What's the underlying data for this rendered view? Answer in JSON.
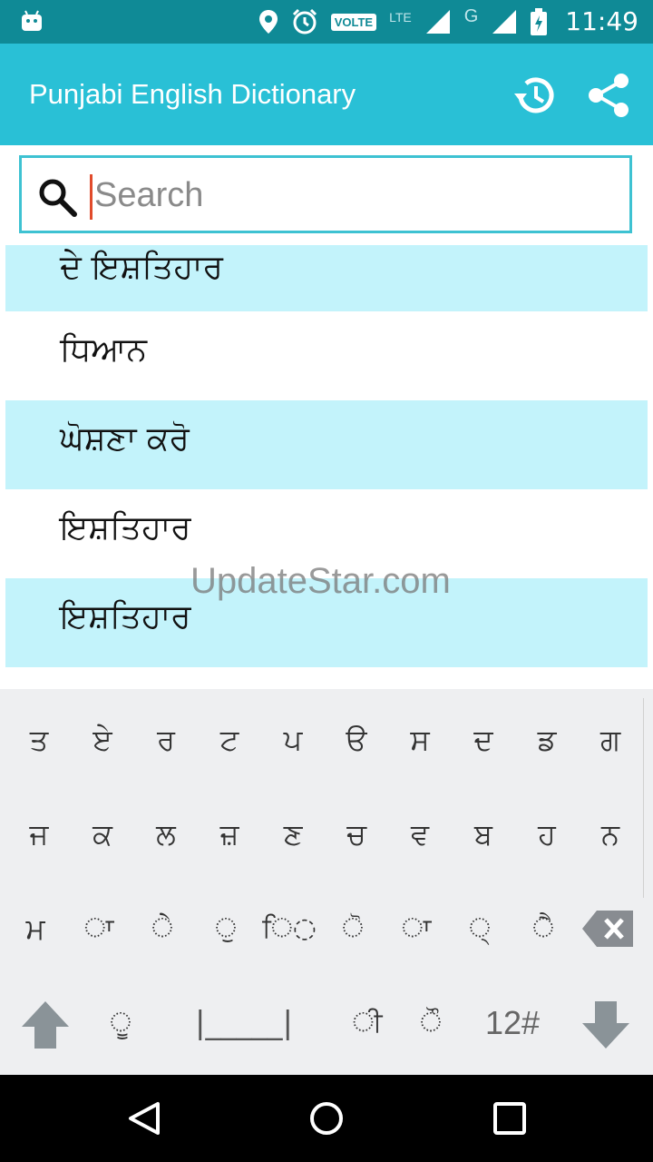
{
  "status_bar": {
    "time": "11:49",
    "volte_label": "VOLTE",
    "lte_label": "LTE",
    "g_label": "G",
    "icons": [
      "android-icon",
      "location-icon",
      "alarm-icon",
      "volte-icon",
      "signal-icon",
      "battery-icon"
    ]
  },
  "app_bar": {
    "title": "Punjabi English Dictionary",
    "icons": [
      "history-icon",
      "share-icon"
    ]
  },
  "search": {
    "placeholder": "Search",
    "value": ""
  },
  "results": [
    {
      "text": "ਦੇ ਇਸ਼ਤਿਹਾਰ",
      "tinted": true
    },
    {
      "text": "ਧਿਆਨ",
      "tinted": false
    },
    {
      "text": "ਘੋਸ਼ਣਾ ਕਰੋ",
      "tinted": true
    },
    {
      "text": "ਇਸ਼ਤਿਹਾਰ",
      "tinted": false
    },
    {
      "text": "ਇਸ਼ਤਿਹਾਰ",
      "tinted": true
    }
  ],
  "watermark": "UpdateStar.com",
  "keyboard": {
    "row1": [
      "ਤ",
      "ਏ",
      "ਰ",
      "ਟ",
      "ਪ",
      "ੳ",
      "ਸ",
      "ਦ",
      "ਡ",
      "ਗ"
    ],
    "row2": [
      "ਜ",
      "ਕ",
      "ਲ",
      "ਜ਼",
      "ਣ",
      "ਚ",
      "ਵ",
      "ਬ",
      "ਹ",
      "ਨ"
    ],
    "row3": [
      "ਮ",
      "◌ਾ",
      "◌ੇ",
      "◌ੁ",
      "ਿ◌",
      "◌ੋ",
      "◌ਾ",
      "◌੍",
      "◌ੈ"
    ],
    "row4": {
      "vowel_uu": "◌ੂ",
      "space": "|_____|",
      "vowel_ii": "◌ੀ",
      "vowel_au": "◌ੌ",
      "numbers": "12#"
    }
  },
  "nav_bar": {
    "icons": [
      "back-icon",
      "home-icon",
      "recents-icon"
    ]
  },
  "colors": {
    "status_bar": "#0f8a96",
    "app_bar": "#29c0d6",
    "row_tint": "#c3f3fb",
    "keyboard_bg": "#eeeff1",
    "cursor": "#e14b2b"
  }
}
